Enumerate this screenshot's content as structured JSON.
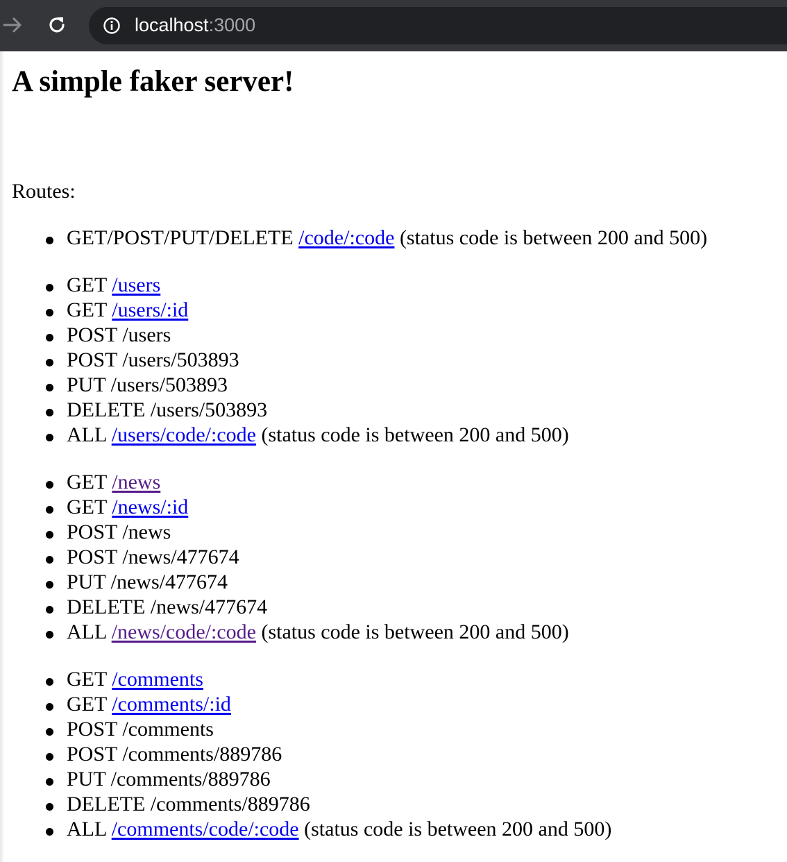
{
  "browser": {
    "url_host": "localhost",
    "url_port": ":3000",
    "toolbar_color": "#35363a",
    "omnibox_color": "#202124"
  },
  "page": {
    "title": "A simple faker server!",
    "routes_label": "Routes:",
    "link_color": "#0000ee",
    "visited_link_color": "#551a8b",
    "groups": [
      {
        "items": [
          {
            "method": "GET/POST/PUT/DELETE ",
            "link": "/code/:code",
            "visited": false,
            "suffix": " (status code is between 200 and 500)"
          }
        ]
      },
      {
        "items": [
          {
            "method": "GET ",
            "link": "/users",
            "visited": false,
            "suffix": ""
          },
          {
            "method": "GET ",
            "link": "/users/:id",
            "visited": false,
            "suffix": ""
          },
          {
            "method": "POST /users",
            "link": "",
            "suffix": ""
          },
          {
            "method": "POST /users/503893",
            "link": "",
            "suffix": ""
          },
          {
            "method": "PUT /users/503893",
            "link": "",
            "suffix": ""
          },
          {
            "method": "DELETE /users/503893",
            "link": "",
            "suffix": ""
          },
          {
            "method": "ALL ",
            "link": "/users/code/:code",
            "visited": false,
            "suffix": " (status code is between 200 and 500)"
          }
        ]
      },
      {
        "items": [
          {
            "method": "GET ",
            "link": "/news",
            "visited": true,
            "suffix": ""
          },
          {
            "method": "GET ",
            "link": "/news/:id",
            "visited": false,
            "suffix": ""
          },
          {
            "method": "POST /news",
            "link": "",
            "suffix": ""
          },
          {
            "method": "POST /news/477674",
            "link": "",
            "suffix": ""
          },
          {
            "method": "PUT /news/477674",
            "link": "",
            "suffix": ""
          },
          {
            "method": "DELETE /news/477674",
            "link": "",
            "suffix": ""
          },
          {
            "method": "ALL ",
            "link": "/news/code/:code",
            "visited": true,
            "suffix": " (status code is between 200 and 500)"
          }
        ]
      },
      {
        "items": [
          {
            "method": "GET ",
            "link": "/comments",
            "visited": false,
            "suffix": ""
          },
          {
            "method": "GET ",
            "link": "/comments/:id",
            "visited": false,
            "suffix": ""
          },
          {
            "method": "POST /comments",
            "link": "",
            "suffix": ""
          },
          {
            "method": "POST /comments/889786",
            "link": "",
            "suffix": ""
          },
          {
            "method": "PUT /comments/889786",
            "link": "",
            "suffix": ""
          },
          {
            "method": "DELETE /comments/889786",
            "link": "",
            "suffix": ""
          },
          {
            "method": "ALL ",
            "link": "/comments/code/:code",
            "visited": false,
            "suffix": " (status code is between 200 and 500)"
          }
        ]
      }
    ]
  }
}
